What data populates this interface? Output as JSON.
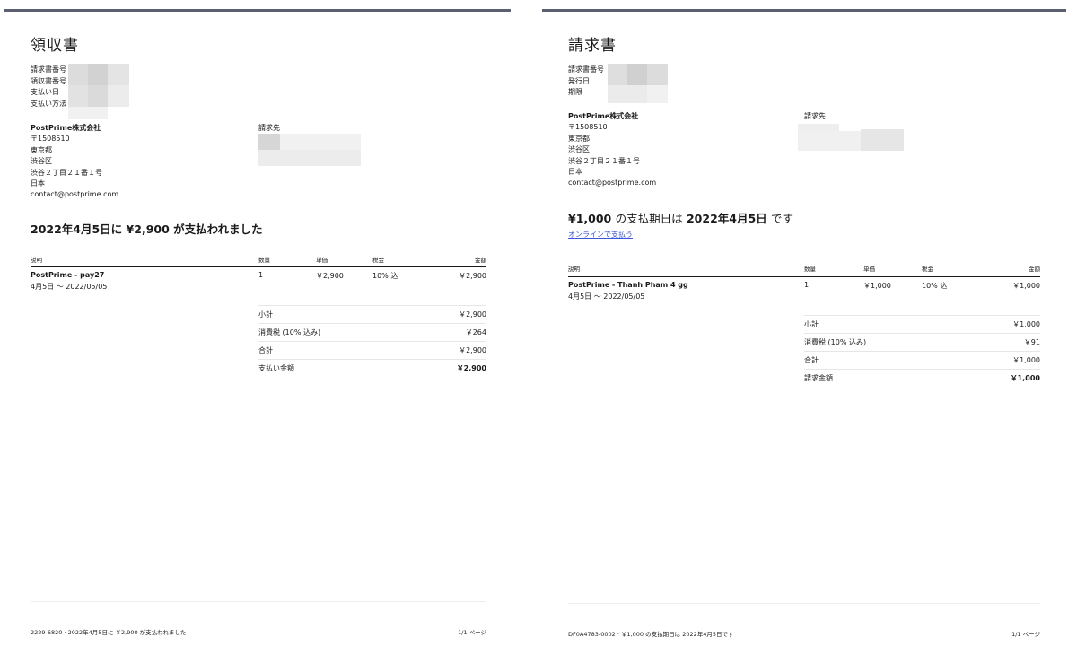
{
  "receipt": {
    "title": "領収書",
    "meta_labels": [
      "請求書番号",
      "領収書番号",
      "支払い日",
      "支払い方法"
    ],
    "seller": {
      "name": "PostPrime株式会社",
      "postal": "〒1508510",
      "prefecture": "東京都",
      "ward": "渋谷区",
      "street": "渋谷２丁目２１番１号",
      "country": "日本",
      "email": "contact@postprime.com"
    },
    "bill_to_label": "請求先",
    "headline_date": "2022年4月5日に",
    "headline_amount": "¥2,900",
    "headline_suffix": "が支払われました",
    "columns": {
      "desc": "説明",
      "qty": "数量",
      "unit": "単価",
      "tax": "税金",
      "amount": "金額"
    },
    "item": {
      "desc": "PostPrime - pay27",
      "period": "4月5日 ～ 2022/05/05",
      "qty": "1",
      "unit": "￥2,900",
      "tax": "10% 込",
      "amount": "￥2,900"
    },
    "summary": [
      {
        "label": "小計",
        "value": "￥2,900"
      },
      {
        "label": "消費税 (10% 込み)",
        "value": "￥264"
      },
      {
        "label": "合計",
        "value": "￥2,900"
      },
      {
        "label": "支払い金額",
        "value": "￥2,900"
      }
    ],
    "footer_left": "2229-6820 · 2022年4月5日に ￥2,900 が支払われました",
    "footer_right": "1/1 ページ"
  },
  "invoice": {
    "title": "請求書",
    "meta_labels": [
      "請求書番号",
      "発行日",
      "期限"
    ],
    "seller": {
      "name": "PostPrime株式会社",
      "postal": "〒1508510",
      "prefecture": "東京都",
      "ward": "渋谷区",
      "street": "渋谷２丁目２１番１号",
      "country": "日本",
      "email": "contact@postprime.com"
    },
    "bill_to_label": "請求先",
    "headline_amount": "¥1,000",
    "headline_mid": "の支払期日は",
    "headline_date": "2022年4月5日",
    "headline_suffix": "です",
    "pay_online": "オンラインで支払う",
    "columns": {
      "desc": "説明",
      "qty": "数量",
      "unit": "単価",
      "tax": "税金",
      "amount": "金額"
    },
    "item": {
      "desc": "PostPrime - Thanh Pham 4 gg",
      "period": "4月5日 ～ 2022/05/05",
      "qty": "1",
      "unit": "￥1,000",
      "tax": "10% 込",
      "amount": "￥1,000"
    },
    "summary": [
      {
        "label": "小計",
        "value": "￥1,000"
      },
      {
        "label": "消費税 (10% 込み)",
        "value": "￥91"
      },
      {
        "label": "合計",
        "value": "￥1,000"
      },
      {
        "label": "請求金額",
        "value": "￥1,000"
      }
    ],
    "footer_left": "DF0A4783-0002 · ￥1,000 の支払期日は 2022年4月5日です",
    "footer_right": "1/1 ページ"
  }
}
